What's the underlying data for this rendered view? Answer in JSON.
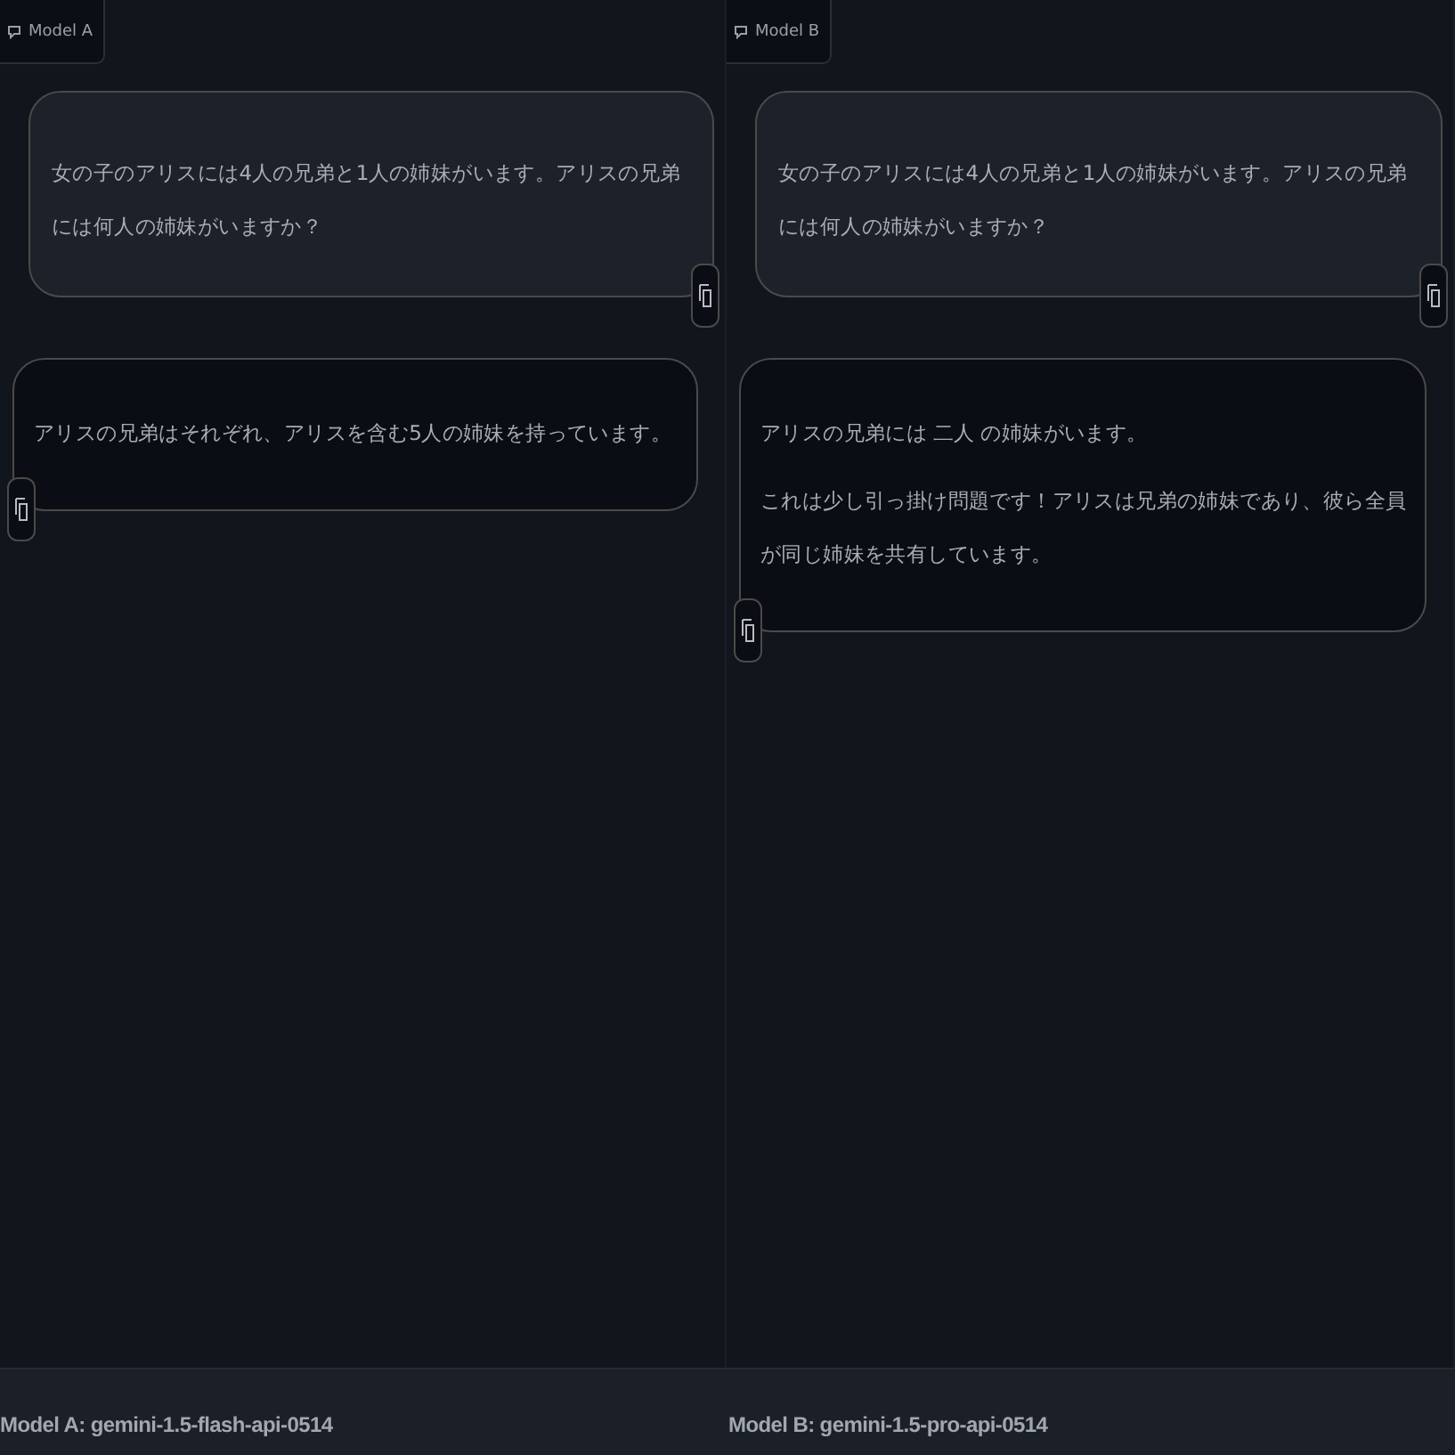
{
  "panels": [
    {
      "label": "Model A",
      "messages": [
        {
          "kind": "user",
          "paragraphs": [
            "女の子のアリスには4人の兄弟と1人の姉妹がいます。アリスの兄弟には何人の姉妹がいますか？"
          ]
        },
        {
          "kind": "bot",
          "paragraphs": [
            "アリスの兄弟はそれぞれ、アリスを含む5人の姉妹を持っています。"
          ]
        }
      ]
    },
    {
      "label": "Model B",
      "messages": [
        {
          "kind": "user",
          "paragraphs": [
            "女の子のアリスには4人の兄弟と1人の姉妹がいます。アリスの兄弟には何人の姉妹がいますか？"
          ]
        },
        {
          "kind": "bot",
          "paragraphs": [
            "アリスの兄弟には 二人 の姉妹がいます。",
            "これは少し引っ掛け問題です！アリスは兄弟の姉妹であり、彼ら全員が同じ姉妹を共有しています。"
          ]
        }
      ]
    }
  ],
  "footer": [
    "Model A: gemini-1.5-flash-api-0514",
    "Model B: gemini-1.5-pro-api-0514"
  ]
}
